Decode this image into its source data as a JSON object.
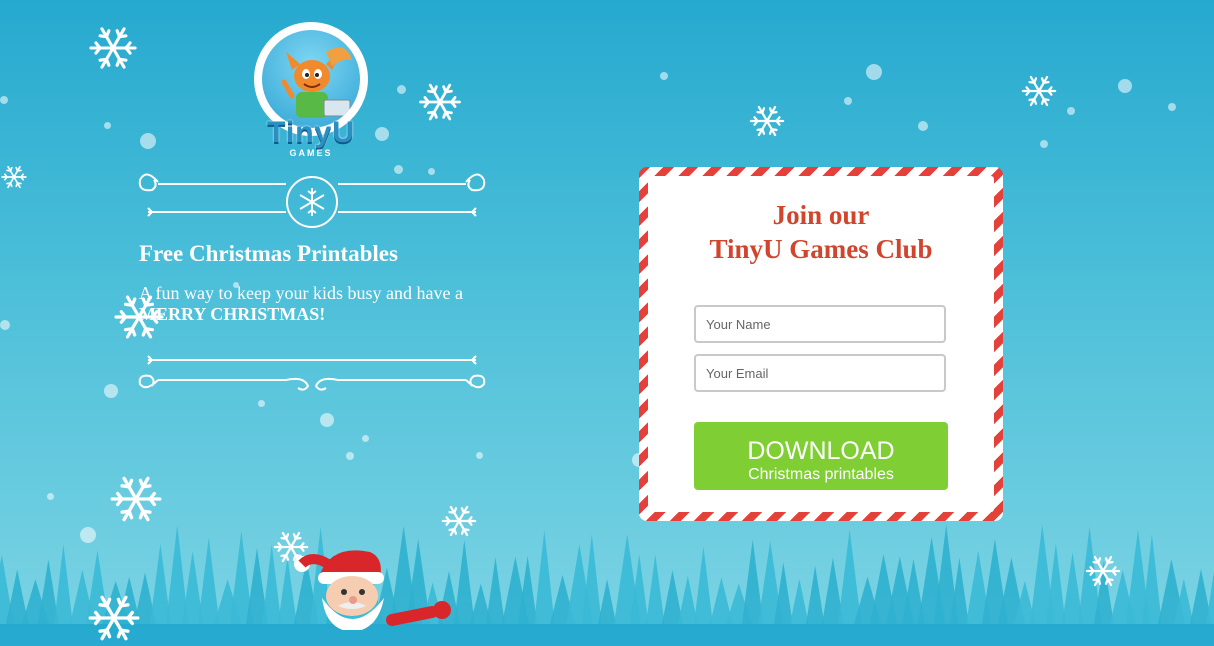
{
  "brand": {
    "name": "TinyU",
    "sub": "GAMES"
  },
  "promo": {
    "headline": "Free Christmas Printables",
    "intro_lead": "A fun way to keep your kids busy and have a",
    "intro_strong": "MERRY CHRISTMAS!"
  },
  "signup": {
    "title_line1": "Join our",
    "title_line2": "TinyU Games Club",
    "name_placeholder": "Your Name",
    "email_placeholder": "Your Email",
    "button_main": "DOWNLOAD",
    "button_sub": "Christmas printables"
  },
  "colors": {
    "sky_top": "#26a9cf",
    "sky_bottom": "#7ad3e3",
    "title_red": "#d2452d",
    "stripe_red": "#e4413a",
    "button_green": "#7fcf34"
  },
  "icons": [
    "snowflake-icon",
    "santa-icon",
    "tinyu-mascot-icon"
  ]
}
